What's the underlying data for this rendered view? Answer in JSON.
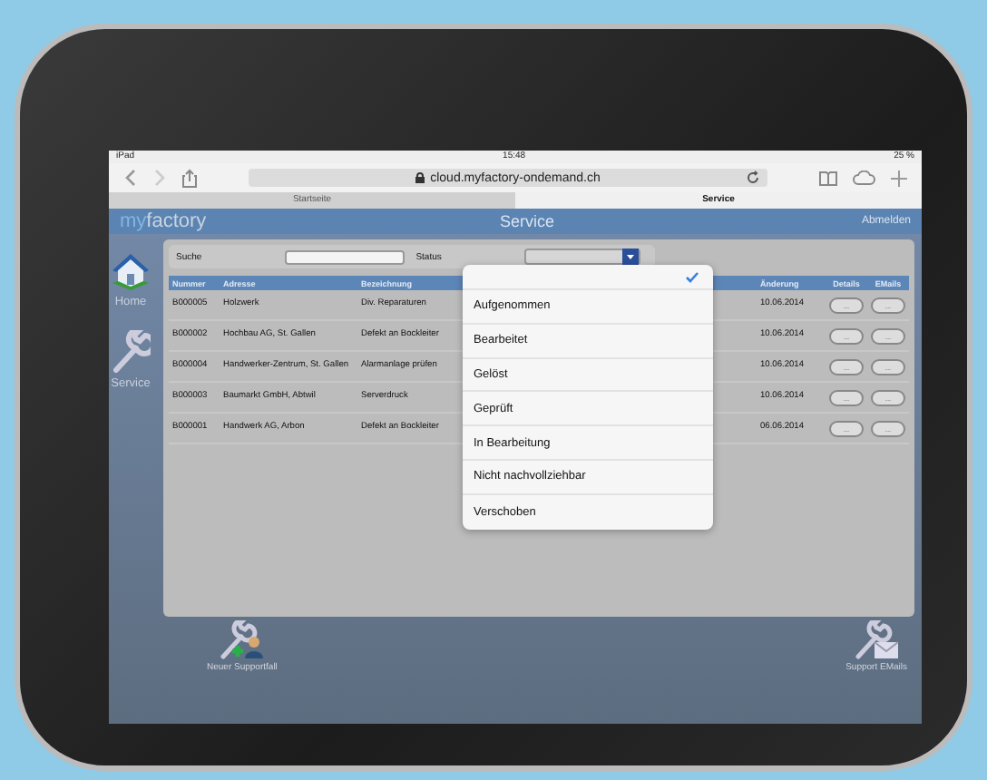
{
  "status_bar": {
    "device": "iPad",
    "time": "15:48",
    "battery": "25 %"
  },
  "browser": {
    "url": "cloud.myfactory-ondemand.ch",
    "tabs": [
      {
        "label": "Startseite",
        "selected": false
      },
      {
        "label": "Service",
        "selected": true
      }
    ]
  },
  "app_header": {
    "logo_my": "my",
    "logo_factory": "factory",
    "title": "Service",
    "logout": "Abmelden"
  },
  "sidebar": {
    "items": [
      {
        "label": "Home",
        "kind": "home"
      },
      {
        "label": "Service",
        "kind": "service"
      }
    ]
  },
  "filter": {
    "search_label": "Suche",
    "status_label": "Status"
  },
  "table": {
    "columns": [
      "Nummer",
      "Adresse",
      "Bezeichnung",
      "Änderung",
      "Details",
      "EMails"
    ],
    "rows": [
      {
        "nummer": "B000005",
        "adresse": "Holzwerk",
        "bezeichnung": "Div. Reparaturen",
        "aenderung": "10.06.2014",
        "details": "...",
        "emails": "..."
      },
      {
        "nummer": "B000002",
        "adresse": "Hochbau AG, St. Gallen",
        "bezeichnung": "Defekt an Bockleiter",
        "aenderung": "10.06.2014",
        "details": "...",
        "emails": "..."
      },
      {
        "nummer": "B000004",
        "adresse": "Handwerker-Zentrum, St. Gallen",
        "bezeichnung": "Alarmanlage prüfen",
        "aenderung": "10.06.2014",
        "details": "...",
        "emails": "..."
      },
      {
        "nummer": "B000003",
        "adresse": "Baumarkt GmbH, Abtwil",
        "bezeichnung": "Serverdruck",
        "aenderung": "10.06.2014",
        "details": "...",
        "emails": "..."
      },
      {
        "nummer": "B000001",
        "adresse": "Handwerk AG, Arbon",
        "bezeichnung": "Defekt an Bockleiter",
        "aenderung": "06.06.2014",
        "details": "...",
        "emails": "..."
      }
    ]
  },
  "status_dropdown": {
    "options": [
      {
        "selected": true
      },
      {
        "label": "Aufgenommen",
        "selected": false
      },
      {
        "label": "Bearbeitet",
        "selected": false
      },
      {
        "label": "Gelöst",
        "selected": false
      },
      {
        "label": "Geprüft",
        "selected": false
      },
      {
        "label": "In Bearbeitung",
        "selected": false
      },
      {
        "label": "Nicht nachvollziehbar",
        "selected": false
      },
      {
        "label": "Verschoben",
        "selected": false
      }
    ]
  },
  "bottom_actions": [
    {
      "label": "Neuer Supportfall",
      "kind": "new"
    },
    {
      "label": "Support EMails",
      "kind": "mail"
    }
  ]
}
